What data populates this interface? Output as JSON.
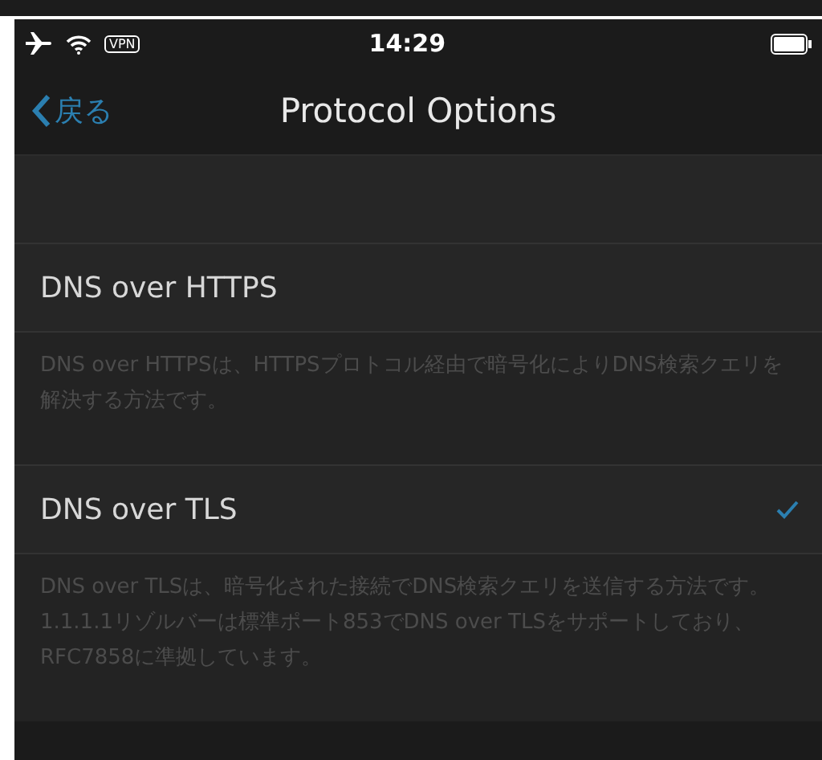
{
  "status_bar": {
    "vpn": "VPN",
    "time": "14:29"
  },
  "nav": {
    "back": "戻る",
    "title": "Protocol Options"
  },
  "options": [
    {
      "label": "DNS over HTTPS",
      "selected": false,
      "description": "DNS over HTTPSは、HTTPSプロトコル経由で暗号化によりDNS検索クエリを解決する方法です。"
    },
    {
      "label": "DNS over TLS",
      "selected": true,
      "description": "DNS over TLSは、暗号化された接続でDNS検索クエリを送信する方法です。1.1.1.1リゾルバーは標準ポート853でDNS over TLSをサポートしており、RFC7858に準拠しています。"
    }
  ]
}
